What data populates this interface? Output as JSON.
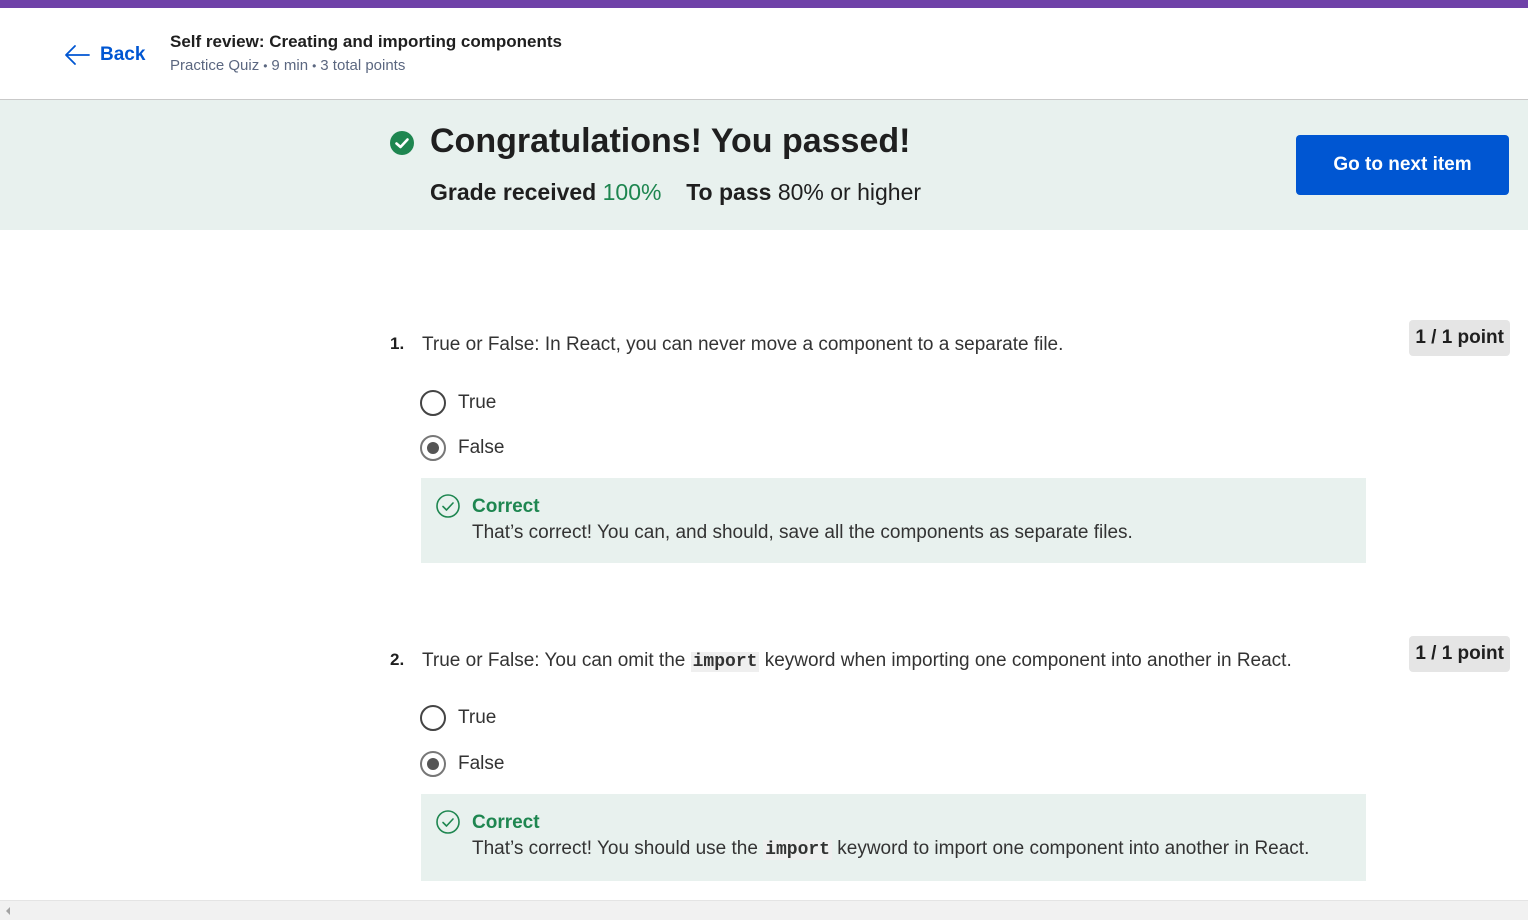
{
  "colors": {
    "brand_bar": "#6f42a8",
    "link": "#0056d2",
    "success": "#1e8650",
    "banner_bg": "#e8f1ee"
  },
  "header": {
    "back_label": "Back",
    "back_icon": "arrow-left-icon",
    "title": "Self review: Creating and importing components",
    "meta": {
      "type": "Practice Quiz",
      "duration": "9 min",
      "points": "3 total points",
      "separator": "•"
    }
  },
  "banner": {
    "icon": "check-circle-icon",
    "headline": "Congratulations! You passed!",
    "grade_label": "Grade received",
    "grade_value": "100%",
    "pass_label": "To pass",
    "pass_value": "80%",
    "pass_suffix": "or higher",
    "next_button": "Go to next item"
  },
  "questions": [
    {
      "number": "1.",
      "text": "True or False: In React, you can never move a component to a separate file.",
      "points": "1 / 1 point",
      "options": [
        {
          "label": "True",
          "selected": false
        },
        {
          "label": "False",
          "selected": true
        }
      ],
      "feedback": {
        "icon": "check-circle-outline-icon",
        "title": "Correct",
        "text": "That’s correct! You can, and should, save all the components as separate files."
      }
    },
    {
      "number": "2.",
      "text_before": "True or False: You can omit the",
      "code": "import",
      "text_after": "keyword when importing one component into another in React.",
      "points": "1 / 1 point",
      "options": [
        {
          "label": "True",
          "selected": false
        },
        {
          "label": "False",
          "selected": true
        }
      ],
      "feedback": {
        "icon": "check-circle-outline-icon",
        "title": "Correct",
        "text_before": "That’s correct! You should use the",
        "code": "import",
        "text_after": "keyword to import one component into another in React."
      }
    }
  ]
}
